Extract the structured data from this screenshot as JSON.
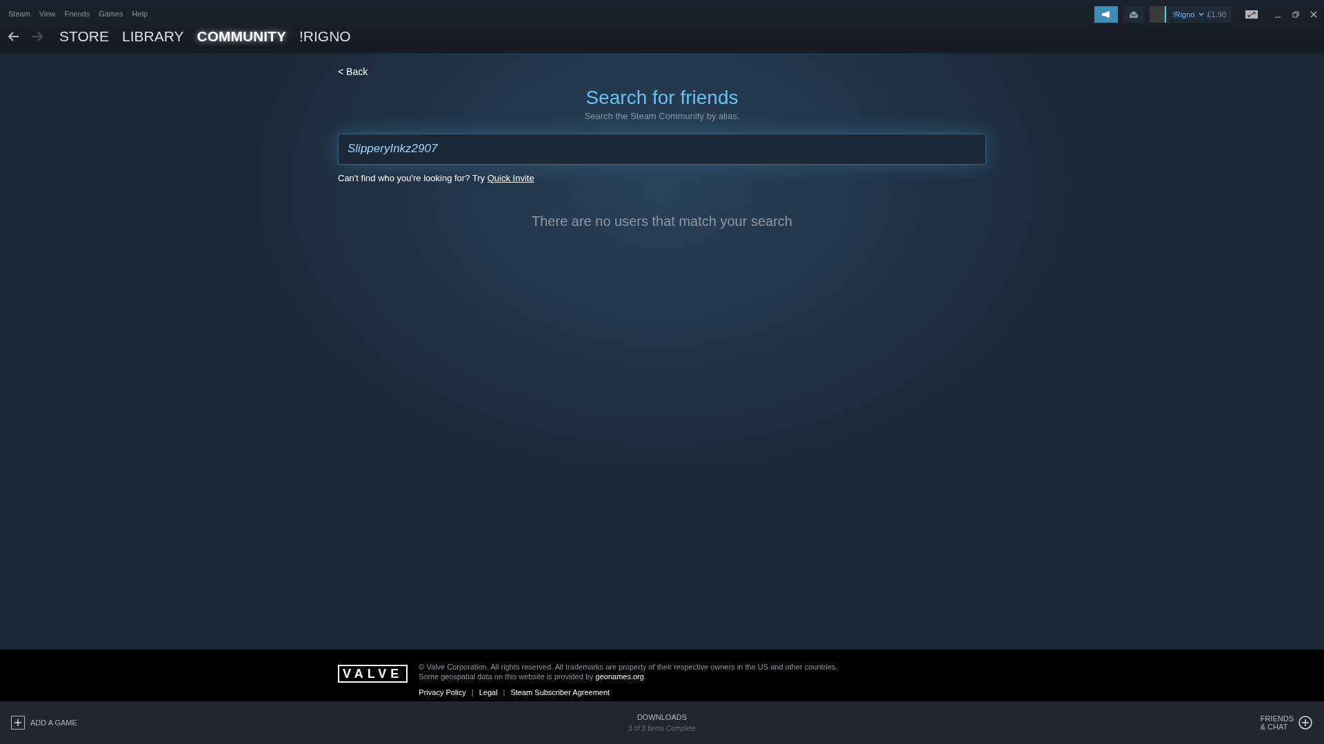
{
  "menu_bar": [
    "Steam",
    "View",
    "Friends",
    "Games",
    "Help"
  ],
  "nav": {
    "tabs": [
      {
        "label": "STORE",
        "selected": false
      },
      {
        "label": "LIBRARY",
        "selected": false
      },
      {
        "label": "COMMUNITY",
        "selected": true
      },
      {
        "label": "!RIGNO",
        "selected": false
      }
    ],
    "forward_disabled": true
  },
  "account": {
    "name": "!Rigno",
    "balance": "£1.90"
  },
  "page": {
    "back": "< Back",
    "title": "Search for friends",
    "subtitle": "Search the Steam Community by alias.",
    "search_value": "SlipperyInkz2907",
    "hint": "Can't find who you're looking for? Try",
    "hint_link": "Quick Invite",
    "empty_message": "There are no users that match your search"
  },
  "footer": {
    "logo": "VALVE",
    "copyright": "© Valve Corporation. All rights reserved. All trademarks are property of their respective owners in the US and other countries.",
    "geo_text": "Some geospatial data on this website is provided by",
    "geo_link": "geonames.org",
    "geo_end": ".",
    "links": [
      {
        "kind": "link",
        "text": "Privacy Policy"
      },
      {
        "kind": "separator",
        "text": "|"
      },
      {
        "kind": "link",
        "text": "Legal"
      },
      {
        "kind": "separator",
        "text": "|"
      },
      {
        "kind": "link",
        "text": "Steam Subscriber Agreement"
      }
    ]
  },
  "bottom_bar": {
    "add_game": "ADD A GAME",
    "downloads_title": "DOWNLOADS",
    "downloads_status": "3 of 3 Items Complete",
    "friends_line1": "FRIENDS",
    "friends_line2": "& CHAT"
  }
}
